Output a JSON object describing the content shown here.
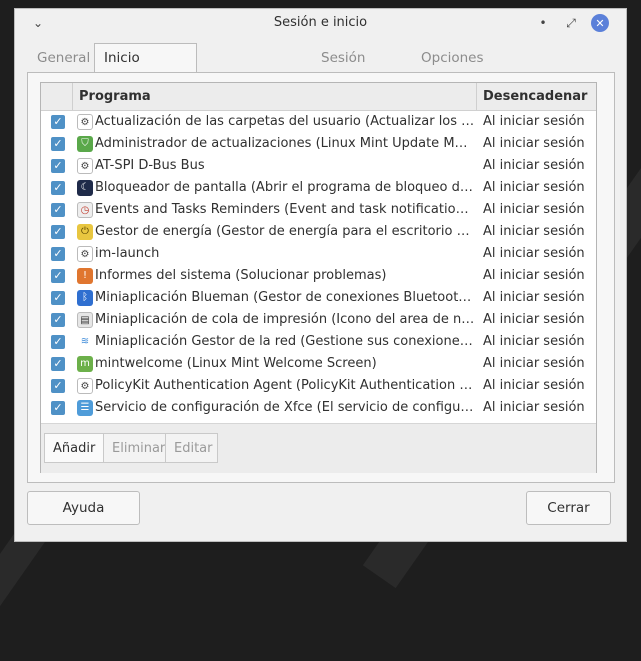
{
  "window": {
    "title": "Sesión e inicio",
    "tabs": [
      {
        "label": "General"
      },
      {
        "label": "Inicio automático de aplicaciones"
      },
      {
        "label": "Sesión actual"
      },
      {
        "label": "Opciones avanzadas"
      }
    ],
    "active_tab": "Inicio automático de aplicaciones"
  },
  "table": {
    "columns": [
      "Programa",
      "Desencadenar"
    ],
    "rows": [
      {
        "checked": true,
        "icon": "gear-icon",
        "name": "Actualización de las carpetas del usuario (Actualizar los nombres de las carpetas)",
        "trigger": "Al iniciar sesión"
      },
      {
        "checked": true,
        "icon": "shield-icon",
        "name": "Administrador de actualizaciones (Linux Mint Update Manager)",
        "trigger": "Al iniciar sesión"
      },
      {
        "checked": true,
        "icon": "gear-icon",
        "name": "AT-SPI D-Bus Bus",
        "trigger": "Al iniciar sesión"
      },
      {
        "checked": true,
        "icon": "moon-icon",
        "name": "Bloqueador de pantalla (Abrir el programa de bloqueo de pantalla)",
        "trigger": "Al iniciar sesión"
      },
      {
        "checked": true,
        "icon": "clock-icon",
        "name": "Events and Tasks Reminders (Event and task notifications)",
        "trigger": "Al iniciar sesión"
      },
      {
        "checked": true,
        "icon": "power-icon",
        "name": "Gestor de energía (Gestor de energía para el escritorio Xfce)",
        "trigger": "Al iniciar sesión"
      },
      {
        "checked": true,
        "icon": "gear-icon",
        "name": "im-launch",
        "trigger": "Al iniciar sesión"
      },
      {
        "checked": true,
        "icon": "warning-icon",
        "name": "Informes del sistema (Solucionar problemas)",
        "trigger": "Al iniciar sesión"
      },
      {
        "checked": true,
        "icon": "bluetooth-icon",
        "name": "Miniaplicación Blueman (Gestor de conexiones Bluetooth Blueman)",
        "trigger": "Al iniciar sesión"
      },
      {
        "checked": true,
        "icon": "printer-icon",
        "name": "Miniaplicación de cola de impresión (Icono del area de notificación)",
        "trigger": "Al iniciar sesión"
      },
      {
        "checked": true,
        "icon": "wifi-icon",
        "name": "Miniaplicación Gestor de la red (Gestione sus conexiones de red)",
        "trigger": "Al iniciar sesión"
      },
      {
        "checked": true,
        "icon": "mint-icon",
        "name": "mintwelcome (Linux Mint Welcome Screen)",
        "trigger": "Al iniciar sesión"
      },
      {
        "checked": true,
        "icon": "gear-icon",
        "name": "PolicyKit Authentication Agent (PolicyKit Authentication Agent)",
        "trigger": "Al iniciar sesión"
      },
      {
        "checked": true,
        "icon": "settings-icon",
        "name": "Servicio de configuración de Xfce (El servicio de configuración de Xfce)",
        "trigger": "Al iniciar sesión"
      }
    ]
  },
  "actions": {
    "add": "Añadir",
    "remove": "Eliminar",
    "edit": "Editar"
  },
  "footer": {
    "help": "Ayuda",
    "close": "Cerrar"
  },
  "colors": {
    "checkbox": "#4f91c6",
    "close_button": "#5b80d9"
  }
}
